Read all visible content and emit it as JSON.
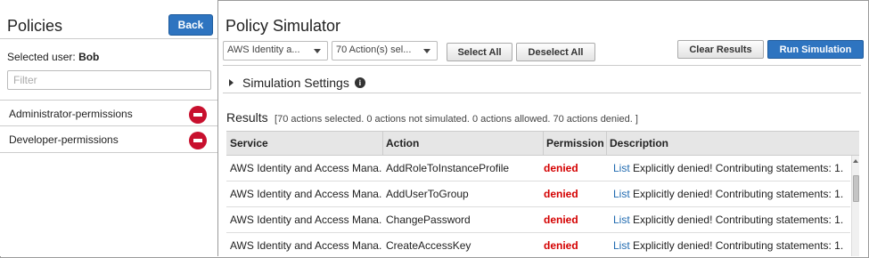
{
  "left": {
    "title": "Policies",
    "back_label": "Back",
    "selected_user_label": "Selected user:",
    "selected_user": "Bob",
    "filter_placeholder": "Filter",
    "policies": [
      {
        "name": "Administrator-permissions",
        "status_icon": "deny-icon"
      },
      {
        "name": "Developer-permissions",
        "status_icon": "deny-icon"
      }
    ]
  },
  "main": {
    "title": "Policy Simulator",
    "service_dropdown": "AWS Identity a...",
    "actions_dropdown": "70 Action(s) sel...",
    "select_all": "Select All",
    "deselect_all": "Deselect All",
    "clear_results": "Clear Results",
    "run_simulation": "Run Simulation",
    "simulation_settings": "Simulation Settings",
    "results_label": "Results",
    "results_summary": "[70 actions selected. 0 actions not simulated. 0 actions allowed. 70 actions denied. ]",
    "columns": [
      "Service",
      "Action",
      "Permission",
      "Description"
    ],
    "rows": [
      {
        "service": "AWS Identity and Access Mana...",
        "action": "AddRoleToInstanceProfile",
        "permission": "denied",
        "link": "List",
        "description": "Explicitly denied! Contributing statements: 1."
      },
      {
        "service": "AWS Identity and Access Mana...",
        "action": "AddUserToGroup",
        "permission": "denied",
        "link": "List",
        "description": "Explicitly denied! Contributing statements: 1."
      },
      {
        "service": "AWS Identity and Access Mana...",
        "action": "ChangePassword",
        "permission": "denied",
        "link": "List",
        "description": "Explicitly denied! Contributing statements: 1."
      },
      {
        "service": "AWS Identity and Access Mana...",
        "action": "CreateAccessKey",
        "permission": "denied",
        "link": "List",
        "description": "Explicitly denied! Contributing statements: 1."
      }
    ]
  },
  "colors": {
    "primary_button": "#2e74c0",
    "denied": "#d40000",
    "link": "#1f6ab0"
  }
}
